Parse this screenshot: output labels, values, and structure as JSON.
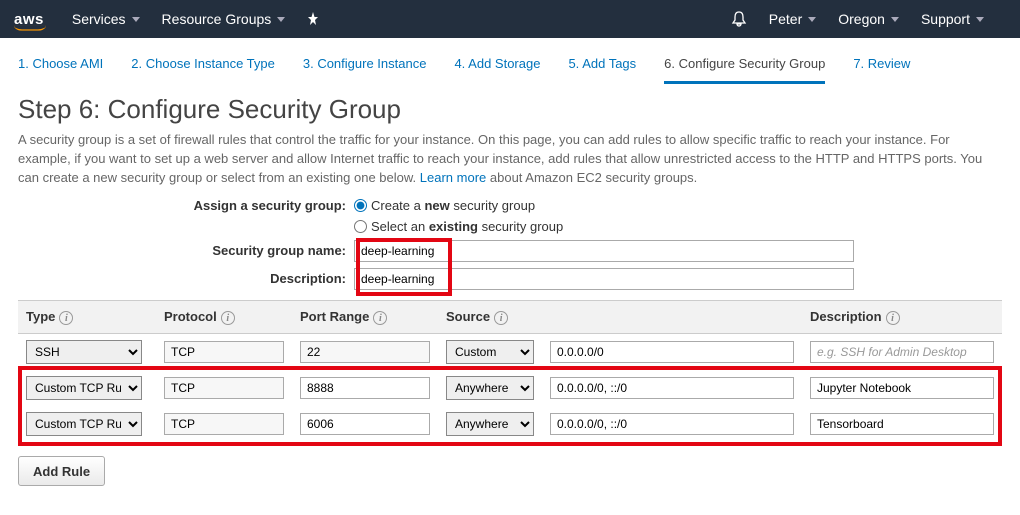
{
  "topnav": {
    "logo": "aws",
    "services": "Services",
    "resource_groups": "Resource Groups",
    "user": "Peter",
    "region": "Oregon",
    "support": "Support"
  },
  "wizard": {
    "s1": "1. Choose AMI",
    "s2": "2. Choose Instance Type",
    "s3": "3. Configure Instance",
    "s4": "4. Add Storage",
    "s5": "5. Add Tags",
    "s6": "6. Configure Security Group",
    "s7": "7. Review"
  },
  "heading": "Step 6: Configure Security Group",
  "desc_a": "A security group is a set of firewall rules that control the traffic for your instance. On this page, you can add rules to allow specific traffic to reach your instance. For example, if you want to set up a web server and allow Internet traffic to reach your instance, add rules that allow unrestricted access to the HTTP and HTTPS ports. You can create a new security group or select from an existing one below. ",
  "learn": "Learn more",
  "desc_b": " about Amazon EC2 security groups.",
  "assign_label": "Assign a security group:",
  "opt_new_a": "Create a ",
  "opt_new_b": "new",
  "opt_new_c": " security group",
  "opt_existing_a": "Select an ",
  "opt_existing_b": "existing",
  "opt_existing_c": " security group",
  "sgname_label": "Security group name:",
  "sgname_value": "deep-learning",
  "sgdesc_label": "Description:",
  "sgdesc_value": "deep-learning",
  "cols": {
    "type": "Type",
    "protocol": "Protocol",
    "port": "Port Range",
    "source": "Source",
    "desc": "Description"
  },
  "rows": [
    {
      "type": "SSH",
      "protocol": "TCP",
      "port": "22",
      "src_sel": "Custom",
      "src_val": "0.0.0.0/0",
      "desc": "",
      "desc_ph": "e.g. SSH for Admin Desktop"
    },
    {
      "type": "Custom TCP Rule",
      "protocol": "TCP",
      "port": "8888",
      "src_sel": "Anywhere",
      "src_val": "0.0.0.0/0, ::/0",
      "desc": "Jupyter Notebook",
      "desc_ph": ""
    },
    {
      "type": "Custom TCP Rule",
      "protocol": "TCP",
      "port": "6006",
      "src_sel": "Anywhere",
      "src_val": "0.0.0.0/0, ::/0",
      "desc": "Tensorboard",
      "desc_ph": ""
    }
  ],
  "add_rule": "Add Rule"
}
